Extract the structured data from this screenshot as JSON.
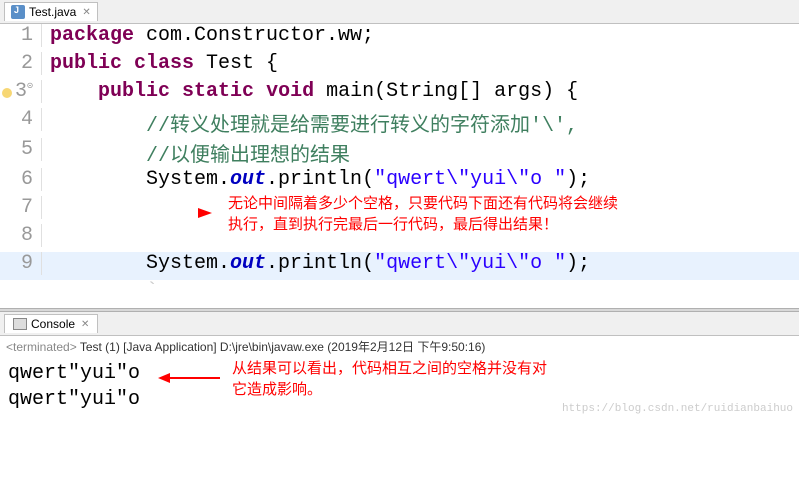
{
  "editorTab": {
    "fileName": "Test.java",
    "close": "✕"
  },
  "code": {
    "l1": {
      "kw1": "package",
      "rest": " com.Constructor.ww;"
    },
    "l2": {
      "kw1": "public",
      "kw2": "class",
      "name": " Test {"
    },
    "l3": {
      "kw1": "public",
      "kw2": "static",
      "kw3": "void",
      "name": " main(String[] args) {"
    },
    "l4": {
      "cm": "//转义处理就是给需要进行转义的字符添加'\\',"
    },
    "l5": {
      "cm": "//以便输出理想的结果"
    },
    "l6": {
      "pre": "System.",
      "out": "out",
      "mid": ".println(",
      "str": "\"qwert\\\"yui\\\"o \"",
      "post": ");"
    },
    "l9": {
      "pre": "System.",
      "out": "out",
      "mid": ".println(",
      "str": "\"qwert\\\"yui\\\"o \"",
      "post": ");"
    }
  },
  "lineNums": {
    "1": "1",
    "2": "2",
    "3": "3",
    "4": "4",
    "5": "5",
    "6": "6",
    "7": "7",
    "8": "8",
    "9": "9"
  },
  "annotation1": {
    "line1": "无论中间隔着多少个空格，只要代码下面还有代码将会继续",
    "line2": "执行，直到执行完最后一行代码，最后得出结果！"
  },
  "consoleTab": {
    "label": "Console",
    "close": "✕"
  },
  "consoleHeader": {
    "term": "<terminated>",
    "rest": " Test (1) [Java Application] D:\\jre\\bin\\javaw.exe (2019年2月12日 下午9:50:16)"
  },
  "consoleOut": {
    "l1": "qwert\"yui\"o",
    "l2": "qwert\"yui\"o"
  },
  "annotation2": {
    "line1": "从结果可以看出，代码相互之间的空格并没有对",
    "line2": "它造成影响。"
  },
  "watermark": "https://blog.csdn.net/ruidianbaihuo"
}
